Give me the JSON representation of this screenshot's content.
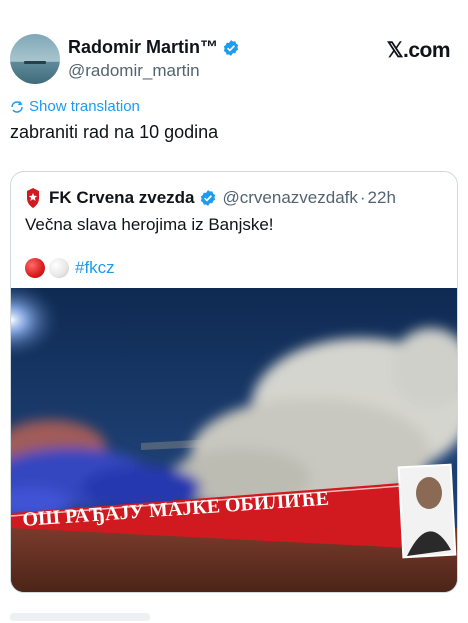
{
  "tweet": {
    "author_name": "Radomir Martin™",
    "author_handle": "@radomir_martin",
    "brand": "𝕏.com",
    "translate_label": "Show translation",
    "text": "zabraniti rad na 10 godina"
  },
  "quoted": {
    "author_name": "FK Crvena zvezda",
    "author_handle": "@crvenazvezdafk",
    "separator": "·",
    "time": "22h",
    "text": "Večna slava herojima iz Banjske!",
    "hashtag": "#fkcz",
    "banner_text": "ОШ РАЂАЈУ МАЈКЕ ОБИЛИЋЕ"
  },
  "colors": {
    "link_blue": "#1d9bf0",
    "muted_gray": "#536471",
    "border": "#cfd9de",
    "banner_red": "#d11a1f"
  },
  "icons": [
    "verified-badge-icon",
    "translate-icon",
    "club-crest-icon",
    "red-circle-emoji",
    "white-circle-emoji"
  ]
}
